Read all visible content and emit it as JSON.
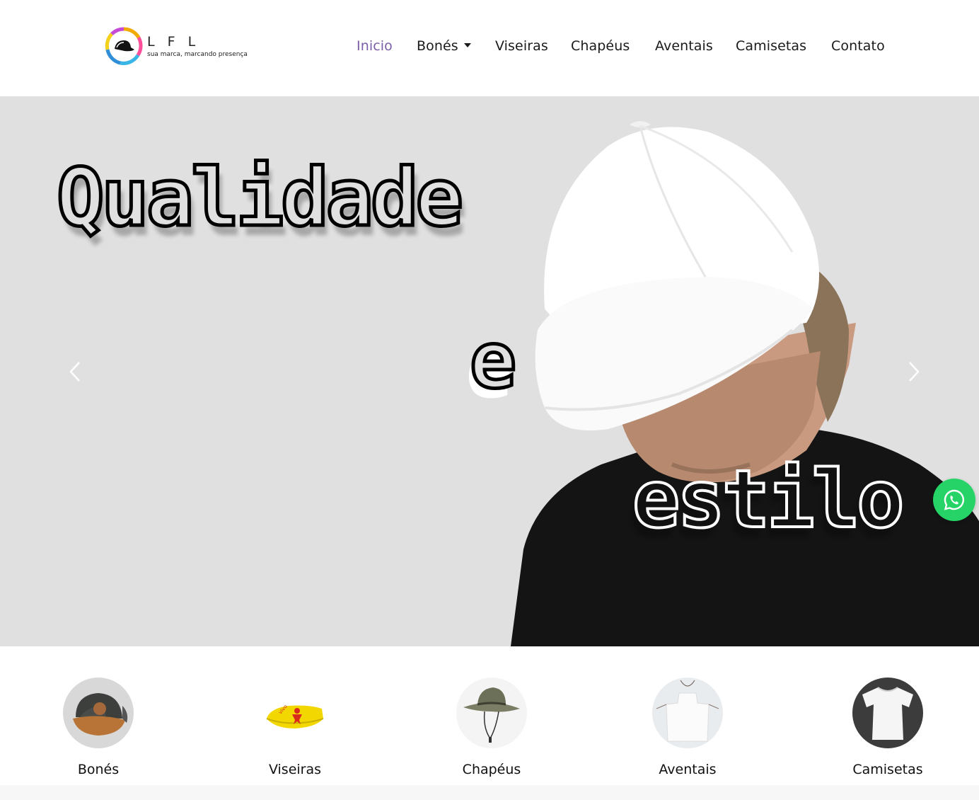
{
  "brand": {
    "letters": "L F L",
    "tagline": "sua marca, marcando presença",
    "logo_icon": "cap-ring-logo-icon"
  },
  "nav": {
    "items": [
      {
        "label": "Inicio",
        "active": true
      },
      {
        "label": "Bonés",
        "dropdown": true
      },
      {
        "label": "Viseiras"
      },
      {
        "label": "Chapéus"
      },
      {
        "label": "Aventais"
      },
      {
        "label": "Camisetas"
      },
      {
        "label": "Contato"
      }
    ],
    "active_color": "#7b5ea7"
  },
  "hero": {
    "line1": "Qualidade",
    "line2": "e",
    "line3": "estilo",
    "background_color": "#e0e0e1",
    "prev_icon": "chevron-left-icon",
    "next_icon": "chevron-right-icon"
  },
  "whatsapp": {
    "icon": "whatsapp-icon",
    "color": "#25d366"
  },
  "categories": [
    {
      "label": "Bonés",
      "icon": "cap-product-image"
    },
    {
      "label": "Viseiras",
      "icon": "visor-product-image"
    },
    {
      "label": "Chapéus",
      "icon": "bucket-hat-product-image"
    },
    {
      "label": "Aventais",
      "icon": "apron-product-image"
    },
    {
      "label": "Camisetas",
      "icon": "tshirt-product-image"
    }
  ]
}
